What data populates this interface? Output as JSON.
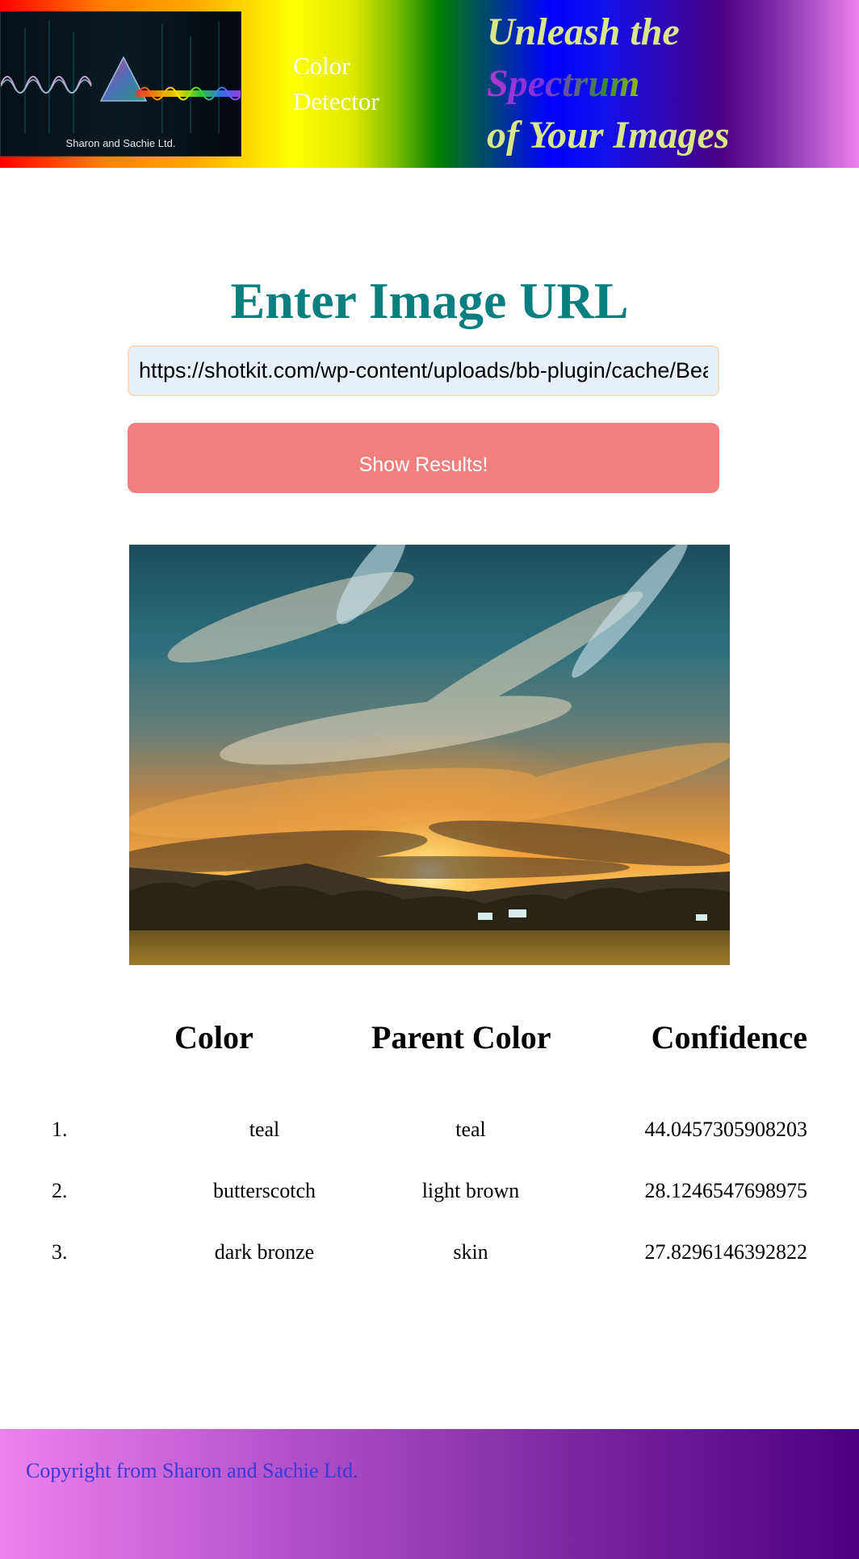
{
  "header": {
    "logo_caption": "Sharon and Sachie Ltd.",
    "app_name_line1": "Color",
    "app_name_line2": "Detector",
    "tagline_line1": "Unleash the",
    "tagline_spectrum": "Spectrum",
    "tagline_line3": "of Your Images"
  },
  "form": {
    "title": "Enter Image URL",
    "url_value": "https://shotkit.com/wp-content/uploads/bb-plugin/cache/Beau",
    "submit_label": "Show Results!"
  },
  "results": {
    "headers": {
      "color": "Color",
      "parent_color": "Parent Color",
      "confidence": "Confidence"
    },
    "rows": [
      {
        "index": "1.",
        "color": "teal",
        "parent_color": "teal",
        "confidence": "44.0457305908203"
      },
      {
        "index": "2.",
        "color": "butterscotch",
        "parent_color": "light brown",
        "confidence": "28.1246547698975"
      },
      {
        "index": "3.",
        "color": "dark bronze",
        "parent_color": "skin",
        "confidence": "27.8296146392822"
      }
    ]
  },
  "footer": {
    "copyright": "Copyright from Sharon and Sachie Ltd."
  },
  "colors": {
    "title_teal": "#0a7f7f",
    "button_salmon": "#f08080",
    "input_bg": "#e8f0fe",
    "footer_text": "#3a3ad6",
    "tagline_yellow": "#d9e68a"
  },
  "icons": {
    "logo": "prism-waveform-logo"
  }
}
